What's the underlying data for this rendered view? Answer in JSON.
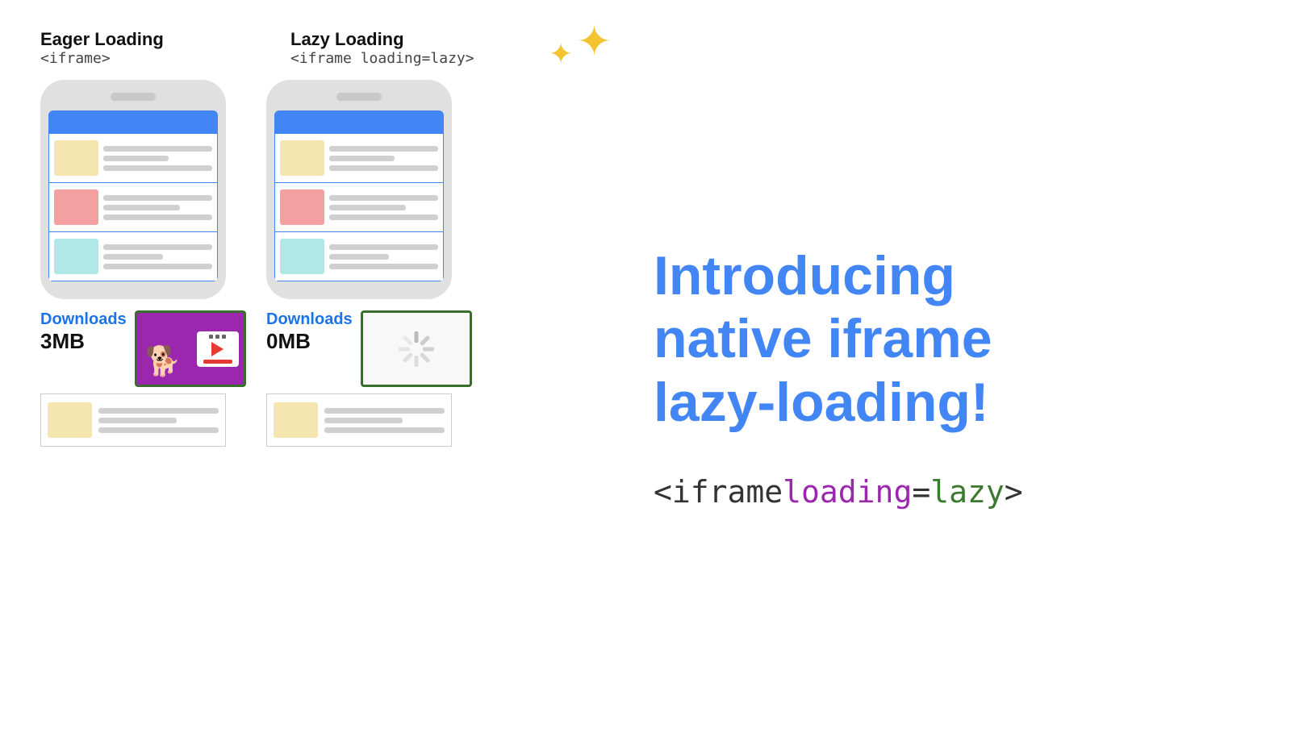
{
  "eager": {
    "title": "Eager Loading",
    "code": "<iframe>",
    "downloads_label": "Downloads",
    "downloads_size": "3MB"
  },
  "lazy": {
    "title": "Lazy Loading",
    "code": "<iframe loading=lazy>",
    "downloads_label": "Downloads",
    "downloads_size": "0MB"
  },
  "intro": {
    "title_line1": "Introducing",
    "title_line2": "native iframe",
    "title_line3": "lazy-loading!"
  },
  "code_snippet": {
    "part1": "<iframe ",
    "part2": "loading",
    "part3": "=",
    "part4": "lazy",
    "part5": ">"
  },
  "sparkle": "✦✦",
  "phone_sections": [
    {
      "thumb": "yellow"
    },
    {
      "thumb": "pink"
    },
    {
      "thumb": "cyan"
    }
  ],
  "below_section": {
    "thumb": "yellow"
  }
}
